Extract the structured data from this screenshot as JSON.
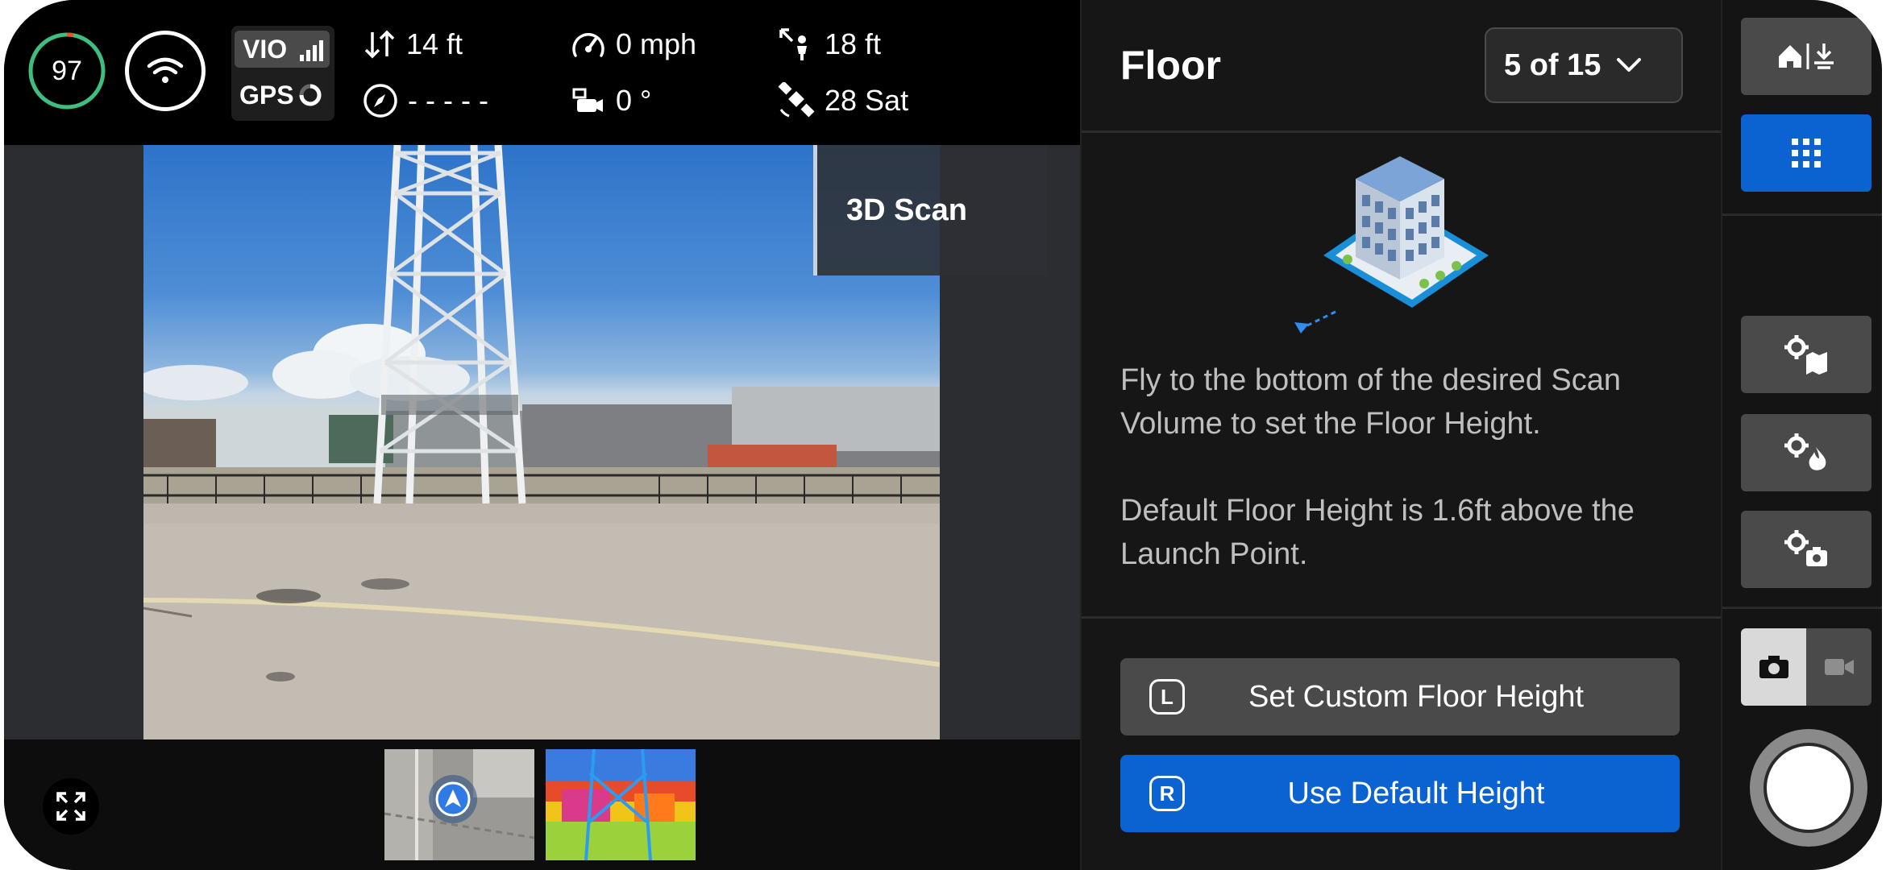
{
  "telemetry": {
    "battery": "97",
    "battery_level_percent": 97,
    "vio_label": "VIO",
    "gps_label": "GPS",
    "altitude": "14 ft",
    "heading": "- - - - -",
    "speed": "0 mph",
    "gimbal_pitch": "0 °",
    "distance": "18 ft",
    "satellites": "28 Sat"
  },
  "video": {
    "overlay_label": "3D Scan"
  },
  "panel": {
    "title": "Floor",
    "step": "5 of 15",
    "instruction_1": "Fly to the bottom of the desired Scan Volume to set the Floor Height.",
    "instruction_2": "Default Floor Height is 1.6ft above the Launch Point.",
    "custom_button": {
      "key": "L",
      "label": "Set Custom Floor Height"
    },
    "default_button": {
      "key": "R",
      "label": "Use Default Height"
    }
  },
  "rail": {
    "icons": [
      "home-land-icon",
      "grid-icon",
      "settings-map-icon",
      "settings-thermal-icon",
      "settings-camera-icon"
    ],
    "active": "grid-icon",
    "capture_mode": "photo"
  },
  "colors": {
    "accent_blue": "#0a63d1",
    "battery_green": "#3fbf7f",
    "battery_warn": "#e8542a"
  }
}
